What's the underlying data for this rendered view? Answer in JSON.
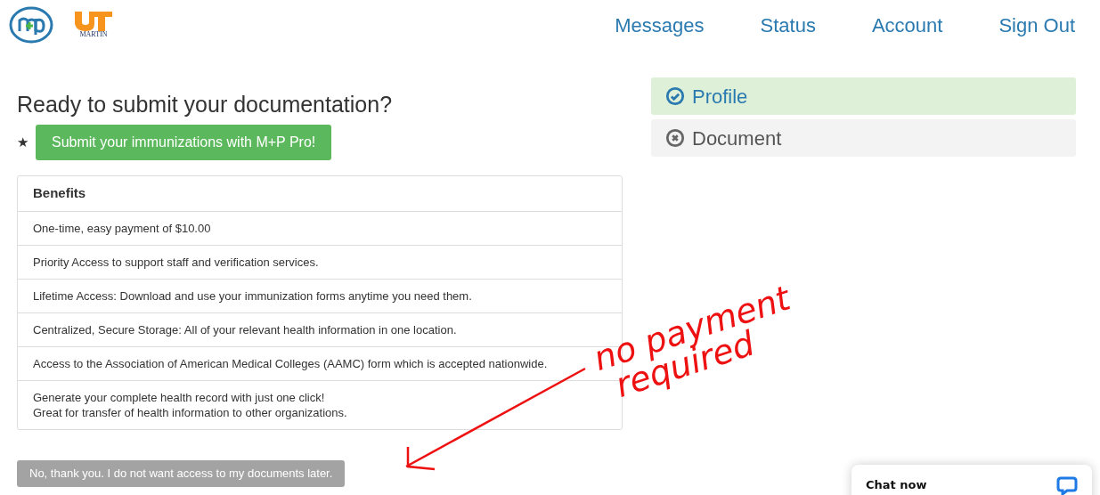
{
  "header": {
    "logo_text": "MARTIN",
    "nav": [
      "Messages",
      "Status",
      "Account",
      "Sign Out"
    ]
  },
  "heading": "Ready to submit your documentation?",
  "promo": {
    "mark": "★",
    "button": "Submit your immunizations with M+P Pro!"
  },
  "benefits": {
    "title": "Benefits",
    "rows": [
      {
        "lines": [
          "One-time, easy payment of $10.00"
        ]
      },
      {
        "lines": [
          "Priority Access to support staff and verification services."
        ]
      },
      {
        "lines": [
          "Lifetime Access: Download and use your immunization forms anytime you need them."
        ]
      },
      {
        "lines": [
          "Centralized, Secure Storage: All of your relevant health information in one location."
        ]
      },
      {
        "lines": [
          "Access to the Association of American Medical Colleges (AAMC) form which is accepted nationwide."
        ]
      },
      {
        "lines": [
          "Generate your complete health record with just one click!",
          "Great for transfer of health information to other organizations."
        ]
      }
    ]
  },
  "decline_button": "No, thank you. I do not want access to my documents later.",
  "steps": [
    {
      "label": "Profile",
      "done": true
    },
    {
      "label": "Document",
      "done": false
    }
  ],
  "annotation": {
    "lines": [
      "no payment",
      "required"
    ]
  },
  "chat": {
    "label": "Chat now"
  }
}
